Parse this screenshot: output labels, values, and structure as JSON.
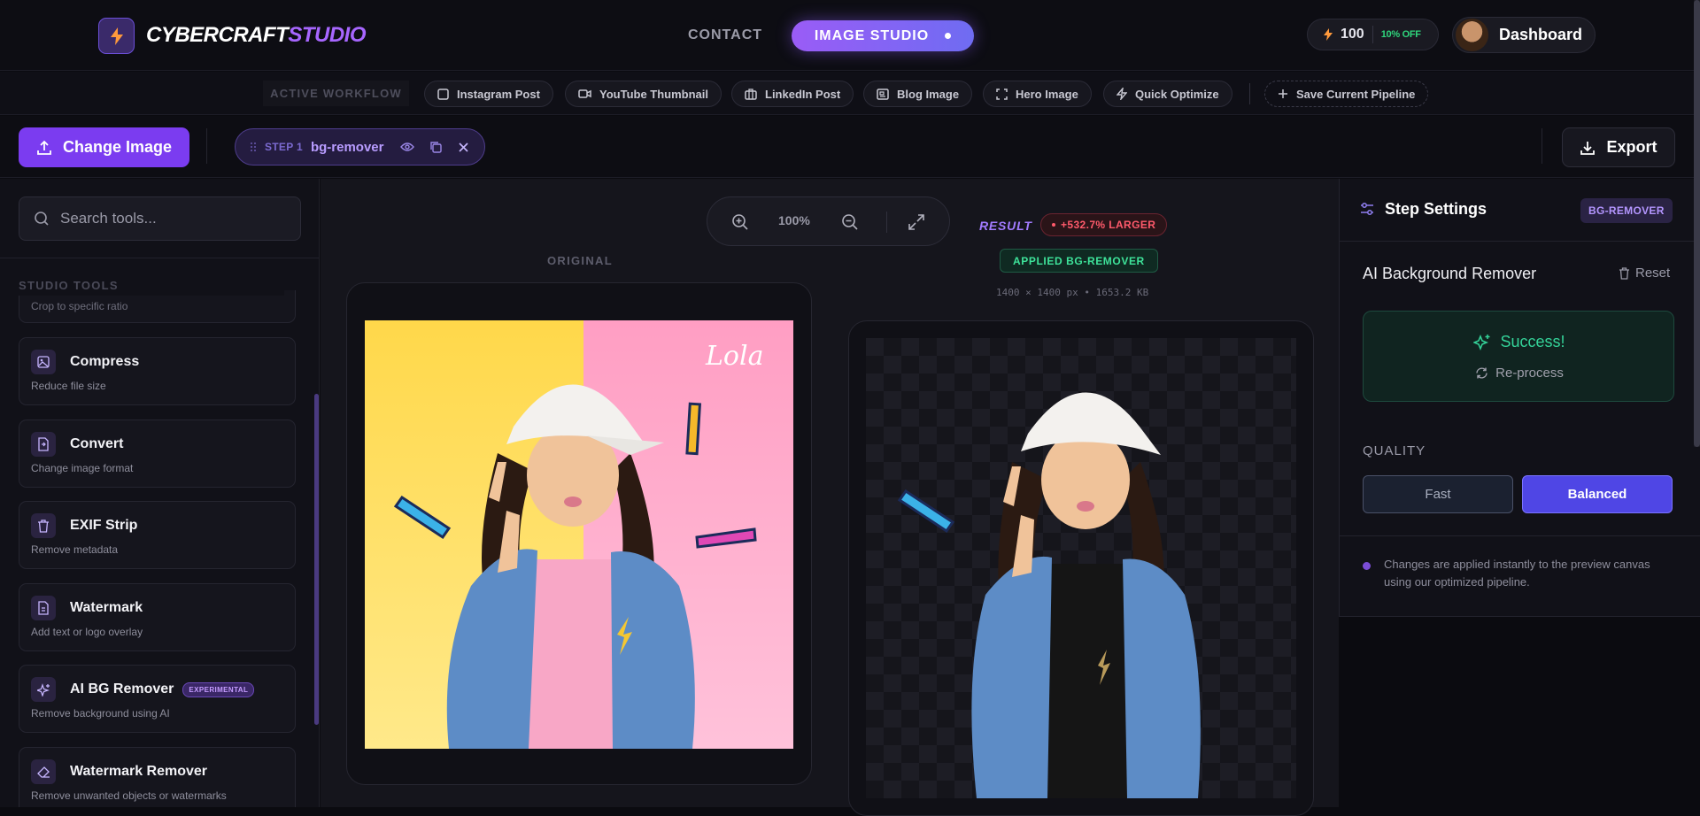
{
  "brand": {
    "name_white": "CYBERCRAFT",
    "name_purple": "STUDIO"
  },
  "nav": {
    "contact": "CONTACT",
    "image_studio": "IMAGE STUDIO"
  },
  "credits": {
    "amount": "100",
    "discount": "10% OFF"
  },
  "user": {
    "dashboard_label": "Dashboard"
  },
  "workflow": {
    "label": "ACTIVE WORKFLOW",
    "presets": [
      "Instagram Post",
      "YouTube Thumbnail",
      "LinkedIn Post",
      "Blog Image",
      "Hero Image",
      "Quick Optimize"
    ],
    "save_label": "Save Current Pipeline"
  },
  "toolbar": {
    "change_image": "Change Image",
    "step_label": "STEP 1",
    "step_name": "bg-remover",
    "export": "Export"
  },
  "sidebar": {
    "search_placeholder": "Search tools...",
    "section": "STUDIO TOOLS",
    "partial_desc": "Crop to specific ratio",
    "tools": [
      {
        "title": "Compress",
        "desc": "Reduce file size",
        "icon": "image-icon"
      },
      {
        "title": "Convert",
        "desc": "Change image format",
        "icon": "file-convert-icon"
      },
      {
        "title": "EXIF Strip",
        "desc": "Remove metadata",
        "icon": "trash-icon"
      },
      {
        "title": "Watermark",
        "desc": "Add text or logo overlay",
        "icon": "file-text-icon"
      },
      {
        "title": "AI BG Remover",
        "desc": "Remove background using AI",
        "icon": "sparkles-icon",
        "badge": "EXPERIMENTAL"
      },
      {
        "title": "Watermark Remover",
        "desc": "Remove unwanted objects or watermarks",
        "icon": "eraser-icon"
      }
    ]
  },
  "canvas": {
    "zoom": "100%",
    "original_label": "ORIGINAL",
    "result_label": "RESULT",
    "size_change": "+532.7% LARGER",
    "applied": "APPLIED BG-REMOVER",
    "meta": "1400 × 1400 px • 1653.2 KB",
    "sticker_text": "Lola"
  },
  "settings": {
    "title": "Step Settings",
    "badge": "BG-REMOVER",
    "tool_name": "AI Background Remover",
    "reset": "Reset",
    "success": "Success!",
    "reprocess": "Re-process",
    "quality_label": "QUALITY",
    "quality_options": [
      "Fast",
      "Balanced"
    ],
    "quality_selected": "Balanced",
    "note": "Changes are applied instantly to the preview canvas using our optimized pipeline."
  },
  "colors": {
    "accent": "#7b3cf0",
    "success": "#34d399",
    "danger": "#ff5a6b",
    "selected": "#4f46e5"
  }
}
